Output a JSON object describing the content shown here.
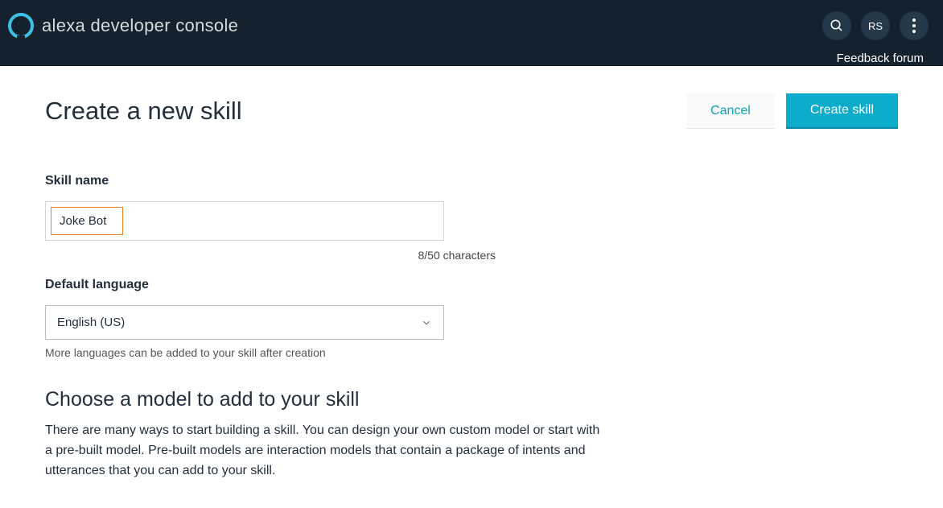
{
  "header": {
    "console_title": "alexa developer console",
    "user_initials": "RS",
    "feedback_link": "Feedback forum"
  },
  "page": {
    "title": "Create a new skill",
    "cancel_label": "Cancel",
    "create_label": "Create skill"
  },
  "form": {
    "skill_name": {
      "label": "Skill name",
      "value": "Joke Bot",
      "counter": "8/50  characters"
    },
    "language": {
      "label": "Default language",
      "selected": "English (US)",
      "hint": "More languages can be added to your skill after creation"
    }
  },
  "model_section": {
    "title": "Choose a model to add to your skill",
    "description": "There are many ways to start building a skill. You can design your own custom model or start with a pre-built model.  Pre-built models are interaction models that contain a package of intents and utterances that you can add to your skill."
  }
}
